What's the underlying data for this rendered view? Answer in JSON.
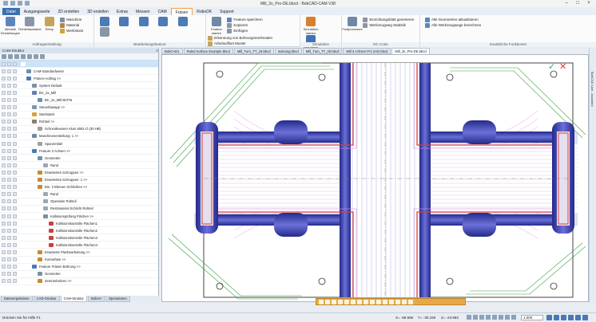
{
  "window": {
    "title": "Mill_3x_Pro-DE.bbcd - BobCAD-CAM V38"
  },
  "menu": {
    "tabs": [
      "Datei",
      "Ausgangsseite",
      "2D erstellen",
      "3D erstellen",
      "Extras",
      "Messen",
      "CAM",
      "Fräsen",
      "RoboDK",
      "Support"
    ],
    "active": "Fräsen",
    "highlight_label": "CAM"
  },
  "ribbon": {
    "groups": [
      {
        "label": "Auftragserstellung",
        "buttons": [
          "Aktuelle Einstellungen",
          "Rohteilassistent",
          "Setup"
        ],
        "small": [
          "Maschine",
          "Material",
          "Werkstück"
        ]
      },
      {
        "label": "Bearbeitungsfeature",
        "buttons": [
          "",
          "",
          "",
          "",
          "",
          ""
        ],
        "small": []
      },
      {
        "label": "",
        "buttons": [
          "Feature starten"
        ],
        "small": [
          "Feature speichern",
          "Kopieren",
          "Einfügen",
          "Erkennung von Bohrungsmerkmalen",
          "Arbeitsoffset Muster"
        ]
      },
      {
        "label": "Simulation",
        "buttons": [
          "Simulation starten",
          "Simulation stoppen"
        ],
        "small": []
      },
      {
        "label": "NC Code",
        "buttons": [
          "Postprozessor"
        ],
        "small": [
          "Einrichtungsblatt generieren",
          "Werkzeugweg Statistik"
        ]
      },
      {
        "label": "Zusätzliche Funktionen",
        "buttons": [],
        "small": [
          "Alle Geometrien aktualisieren",
          "Alle Werkzeugwege berechnen"
        ]
      }
    ]
  },
  "left_panel": {
    "title": "CAM-Struktur",
    "rows": [
      {
        "label": "",
        "indent": 0,
        "color": "#ffffff"
      },
      {
        "label": "CAM-Standardwerte",
        "indent": 1,
        "color": "#6d8fb5"
      },
      {
        "label": "Fräsen-Auftrag   >>",
        "indent": 1,
        "color": "#4d7ab0"
      },
      {
        "label": "System Default",
        "indent": 2,
        "color": "#7b8fa6"
      },
      {
        "label": "BC_3x_Mill",
        "indent": 2,
        "color": "#5a82b6"
      },
      {
        "label": "BC_3x_Mill.BCPst",
        "indent": 3,
        "color": "#6d8fb5"
      },
      {
        "label": "Steuerbasage   >>",
        "indent": 2,
        "color": "#7a97b8"
      },
      {
        "label": "Werkstück",
        "indent": 2,
        "color": "#d8a03a"
      },
      {
        "label": "Rohteil   >>",
        "indent": 2,
        "color": "#8c7f6a"
      },
      {
        "label": "Schneidewaren Alum 6061-O (30 HB)",
        "indent": 3,
        "color": "#a0a0a0"
      },
      {
        "label": "Maschinenerstellung: 1   >>",
        "indent": 2,
        "color": "#6f88a6"
      },
      {
        "label": "Spannmittel",
        "indent": 3,
        "color": "#9f9f9f"
      },
      {
        "label": "Feature 2 Achsen   >>",
        "indent": 2,
        "color": "#4d7ab0"
      },
      {
        "label": "Geometrie",
        "indent": 3,
        "color": "#7a8ea6"
      },
      {
        "label": "Rand",
        "indent": 4,
        "color": "#9aa8b8"
      },
      {
        "label": "Erweitertes Schruppen   >>",
        "indent": 3,
        "color": "#c58b32"
      },
      {
        "label": "Erweitertes Schruppen: 1   >>",
        "indent": 3,
        "color": "#c58b32"
      },
      {
        "label": "Bm. 2 Ebenen Schlichten   >>",
        "indent": 3,
        "color": "#c58b32"
      },
      {
        "label": "Rand",
        "indent": 4,
        "color": "#9aa8b8"
      },
      {
        "label": "Operation Rohteil",
        "indent": 4,
        "color": "#9aa8b8"
      },
      {
        "label": "Restmaterial Schlicht Rohteil",
        "indent": 4,
        "color": "#9aa8b8"
      },
      {
        "label": "Kollisionsprüfung Flächen   >>",
        "indent": 4,
        "color": "#7a8ea6"
      },
      {
        "label": "Kollisionskontrolle Flächen1",
        "indent": 5,
        "color": "#c9413c"
      },
      {
        "label": "Kollisionskontrolle Flächen2",
        "indent": 5,
        "color": "#c9413c"
      },
      {
        "label": "Kollisionskontrolle Flächen3",
        "indent": 5,
        "color": "#c9413c"
      },
      {
        "label": "Kollisionskontrolle Flächen4",
        "indent": 5,
        "color": "#c9413c"
      },
      {
        "label": "Erweiterte Planbearbeitung   >>",
        "indent": 3,
        "color": "#c58b32"
      },
      {
        "label": "Konturfase   >>",
        "indent": 3,
        "color": "#c58b32"
      },
      {
        "label": "Feature Fräsen Bohrung   >>",
        "indent": 2,
        "color": "#4d7ab0"
      },
      {
        "label": "Geometrie",
        "indent": 3,
        "color": "#7a8ea6"
      },
      {
        "label": "Zentrierbohren   >>",
        "indent": 3,
        "color": "#c58b32"
      },
      {
        "label": "Bohren   >>",
        "indent": 3,
        "color": "#c58b32"
      }
    ],
    "tabs": [
      "Datenergebnisse",
      "CAD-Struktur",
      "CAM-Struktur",
      "BobArt",
      "Operationen"
    ],
    "active_tab": "CAM-Struktur"
  },
  "viewport_tabs": [
    "BobCAD1",
    "Ruled Surface Example.bbcd",
    "Mill_Turn_TT_15.bbcd",
    "Indexing.bbcd",
    "Mill_Turn_TT_25.bbcd",
    "Mill 3 Achsen Pro 2AD.bbcd",
    "Mill_3x_Pro-DE.bbcd"
  ],
  "active_viewport_tab": "Mill_3x_Pro-DE.bbcd",
  "right_strip": {
    "label": "BobCAD Live - Assistent"
  },
  "status": {
    "hint": "Drücken Sie für Hilfe F1",
    "x": "X= -68.596",
    "y": "Y= -30.158",
    "z": "Z= -24.983",
    "zoom": "1.000"
  },
  "colors": {
    "accent": "#3a6fb0",
    "active_tab": "#f0a04a",
    "toolpath_green": "#3da043",
    "toolpath_magenta": "#d64dd0",
    "pocket_blue": "#3b3fbf",
    "pocket_red": "#d8403b"
  }
}
